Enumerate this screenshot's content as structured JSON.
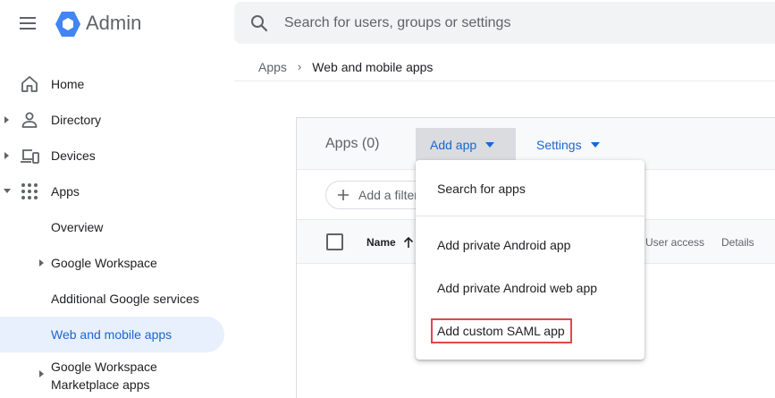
{
  "header": {
    "app_title": "Admin",
    "search_placeholder": "Search for users, groups or settings"
  },
  "breadcrumb": {
    "parent": "Apps",
    "separator": "›",
    "current": "Web and mobile apps"
  },
  "sidebar": {
    "items": [
      {
        "label": "Home"
      },
      {
        "label": "Directory"
      },
      {
        "label": "Devices"
      },
      {
        "label": "Apps"
      },
      {
        "label": "Overview"
      },
      {
        "label": "Google Workspace"
      },
      {
        "label": "Additional Google services"
      },
      {
        "label": "Web and mobile apps"
      },
      {
        "label": "Google Workspace"
      },
      {
        "label": "Marketplace apps"
      }
    ]
  },
  "card": {
    "apps_count": "Apps (0)",
    "add_app_label": "Add app",
    "settings_label": "Settings",
    "filter_placeholder": "Add a filter",
    "columns": {
      "name": "Name",
      "user_access": "User access",
      "details": "Details"
    }
  },
  "add_app_menu": {
    "items": [
      {
        "label": "Search for apps"
      },
      {
        "label": "Add private Android app"
      },
      {
        "label": "Add private Android web app"
      },
      {
        "label": "Add custom SAML app"
      }
    ]
  },
  "colors": {
    "accent_blue": "#1967d2",
    "logo_blue": "#4285f4",
    "selected_bg": "#e8f0fe",
    "highlight_red": "#e0474c"
  },
  "icons": {
    "menu": "hamburger-icon",
    "logo": "google-admin-hexagon-icon",
    "search": "search-icon",
    "home": "home-icon",
    "directory": "person-icon",
    "devices": "devices-icon",
    "apps": "grid-icon"
  }
}
